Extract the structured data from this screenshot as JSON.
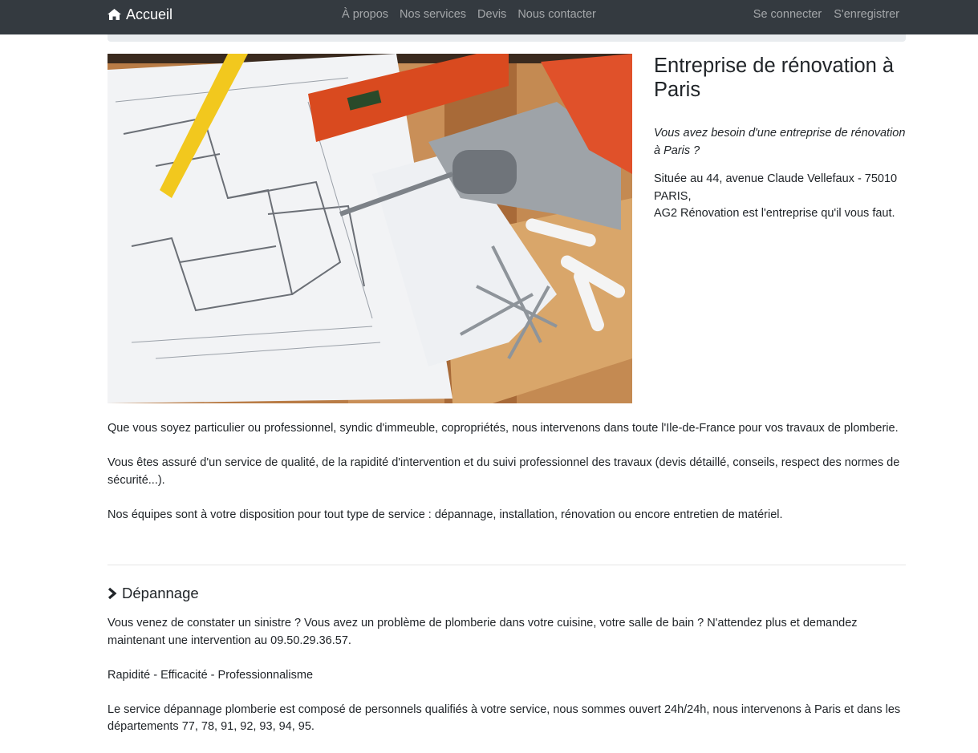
{
  "nav": {
    "brand": "Accueil",
    "links": [
      "À propos",
      "Nos services",
      "Devis",
      "Nous contacter"
    ],
    "login": "Se connecter",
    "register": "S'enregistrer"
  },
  "hero": {
    "title": "Entreprise de rénovation à Paris",
    "question": "Vous avez besoin d'une entreprise de rénovation à Paris ?",
    "address_line1": "Située au 44, avenue Claude Vellefaux - 75010 PARIS,",
    "address_line2": "AG2 Rénovation est l'entreprise qu'il vous faut."
  },
  "intro": [
    "Que vous soyez particulier ou professionnel, syndic d'immeuble, copropriétés, nous intervenons dans toute l'Ile-de-France pour vos travaux de plomberie.",
    "Vous êtes assuré d'un service de qualité, de la rapidité d'intervention et du suivi professionnel des travaux (devis détaillé, conseils, respect des normes de sécurité...).",
    "Nos équipes sont à votre disposition pour tout type de service : dépannage, installation, rénovation ou encore entretien de matériel."
  ],
  "depannage": {
    "title": "Dépannage",
    "paragraphs": [
      "Vous venez de constater un sinistre ? Vous avez un problème de plomberie dans votre cuisine, votre salle de bain ? N'attendez plus et demandez maintenant une intervention au 09.50.29.36.57.",
      "Rapidité - Efficacité - Professionnalisme",
      "Le service dépannage plomberie est composé de personnels qualifiés à votre service, nous sommes ouvert 24h/24h, nous intervenons à Paris et dans les départements 77, 78, 91, 92, 93, 94, 95."
    ]
  }
}
